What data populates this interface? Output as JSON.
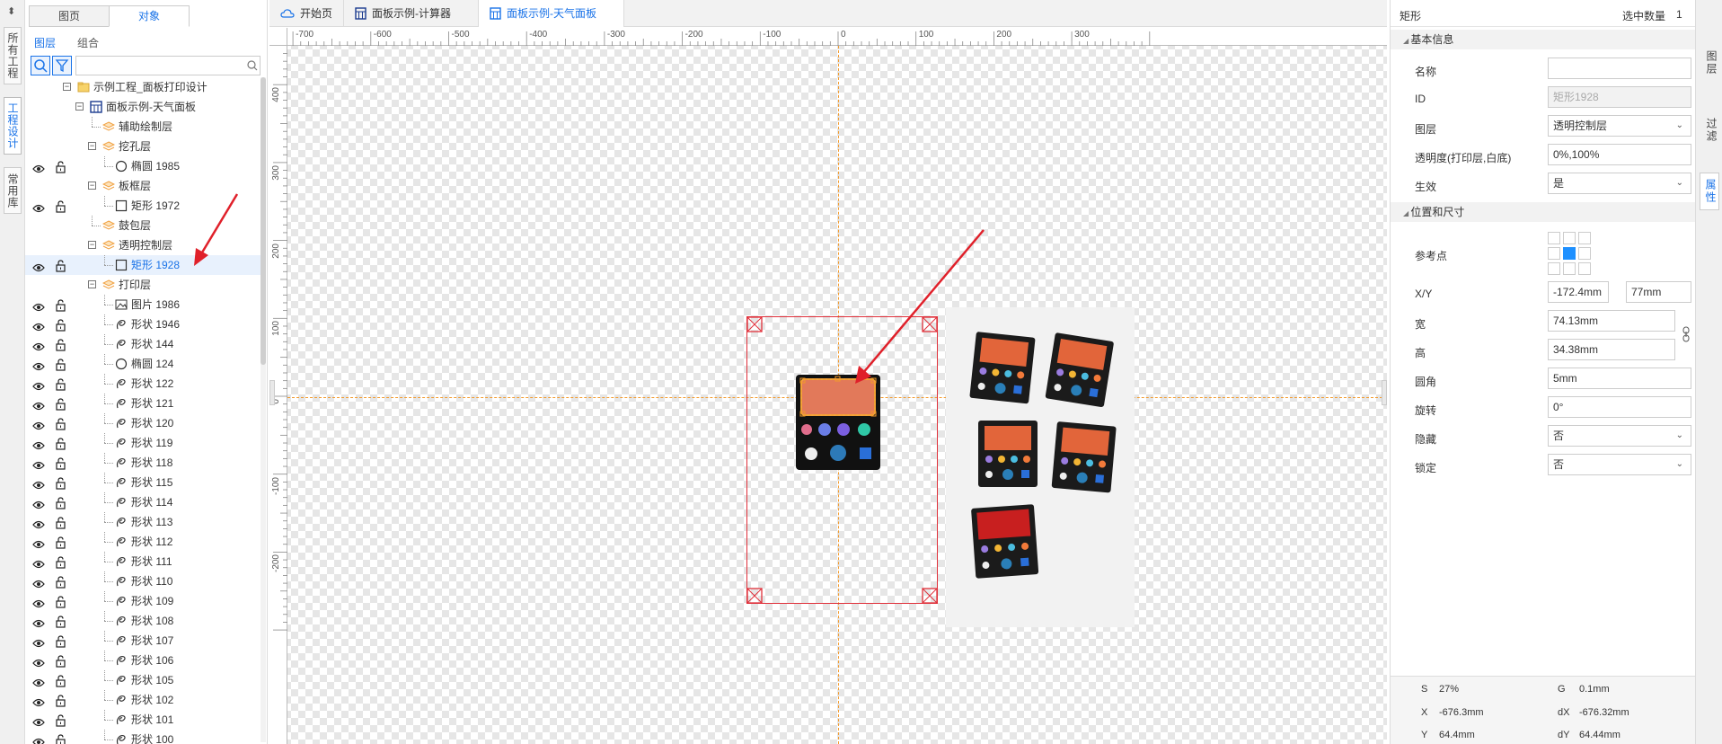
{
  "left_rail": {
    "pin": "⬍",
    "tabs": [
      "所有工程",
      "工程设计",
      "常用库"
    ]
  },
  "tree_panel": {
    "tabs": [
      "图页",
      "对象"
    ],
    "sub_tabs": [
      "图层",
      "组合"
    ],
    "search_placeholder": "",
    "rows": [
      {
        "label": "示例工程_面板打印设计",
        "icon": "folder-icon",
        "level": 0,
        "vis": false
      },
      {
        "label": "面板示例-天气面板",
        "icon": "panel-icon",
        "level": 1,
        "vis": false
      },
      {
        "label": "辅助绘制层",
        "icon": "layer-icon",
        "level": 2,
        "vis": false
      },
      {
        "label": "挖孔层",
        "icon": "layer-icon",
        "level": 2,
        "vis": false,
        "exp": true
      },
      {
        "label": "椭圆 1985",
        "icon": "ellipse-icon",
        "level": 3,
        "vis": true
      },
      {
        "label": "板框层",
        "icon": "layer-icon",
        "level": 2,
        "vis": false,
        "exp": true
      },
      {
        "label": "矩形 1972",
        "icon": "rect-icon",
        "level": 3,
        "vis": true
      },
      {
        "label": "鼓包层",
        "icon": "layer-icon",
        "level": 2,
        "vis": false
      },
      {
        "label": "透明控制层",
        "icon": "layer-icon",
        "level": 2,
        "vis": false,
        "exp": true
      },
      {
        "label": "矩形 1928",
        "icon": "rect-icon",
        "level": 3,
        "vis": true,
        "sel": true
      },
      {
        "label": "打印层",
        "icon": "layer-icon",
        "level": 2,
        "vis": false,
        "exp": true
      },
      {
        "label": "图片 1986",
        "icon": "image-icon",
        "level": 3,
        "vis": true
      },
      {
        "label": "形状 1946",
        "icon": "shape-icon",
        "level": 3,
        "vis": true
      },
      {
        "label": "形状 144",
        "icon": "shape-icon",
        "level": 3,
        "vis": true
      },
      {
        "label": "椭圆 124",
        "icon": "ellipse-icon",
        "level": 3,
        "vis": true
      },
      {
        "label": "形状 122",
        "icon": "shape-icon",
        "level": 3,
        "vis": true
      },
      {
        "label": "形状 121",
        "icon": "shape-icon",
        "level": 3,
        "vis": true
      },
      {
        "label": "形状 120",
        "icon": "shape-icon",
        "level": 3,
        "vis": true
      },
      {
        "label": "形状 119",
        "icon": "shape-icon",
        "level": 3,
        "vis": true
      },
      {
        "label": "形状 118",
        "icon": "shape-icon",
        "level": 3,
        "vis": true
      },
      {
        "label": "形状 115",
        "icon": "shape-icon",
        "level": 3,
        "vis": true
      },
      {
        "label": "形状 114",
        "icon": "shape-icon",
        "level": 3,
        "vis": true
      },
      {
        "label": "形状 113",
        "icon": "shape-icon",
        "level": 3,
        "vis": true
      },
      {
        "label": "形状 112",
        "icon": "shape-icon",
        "level": 3,
        "vis": true
      },
      {
        "label": "形状 111",
        "icon": "shape-icon",
        "level": 3,
        "vis": true
      },
      {
        "label": "形状 110",
        "icon": "shape-icon",
        "level": 3,
        "vis": true
      },
      {
        "label": "形状 109",
        "icon": "shape-icon",
        "level": 3,
        "vis": true
      },
      {
        "label": "形状 108",
        "icon": "shape-icon",
        "level": 3,
        "vis": true
      },
      {
        "label": "形状 107",
        "icon": "shape-icon",
        "level": 3,
        "vis": true
      },
      {
        "label": "形状 106",
        "icon": "shape-icon",
        "level": 3,
        "vis": true
      },
      {
        "label": "形状 105",
        "icon": "shape-icon",
        "level": 3,
        "vis": true
      },
      {
        "label": "形状 102",
        "icon": "shape-icon",
        "level": 3,
        "vis": true
      },
      {
        "label": "形状 101",
        "icon": "shape-icon",
        "level": 3,
        "vis": true
      },
      {
        "label": "形状 100",
        "icon": "shape-icon",
        "level": 3,
        "vis": true
      }
    ]
  },
  "doc_tabs": [
    {
      "label": "开始页",
      "icon": "cloud-icon",
      "active": false
    },
    {
      "label": "面板示例-计算器",
      "icon": "calculator-icon",
      "active": false
    },
    {
      "label": "面板示例-天气面板",
      "icon": "calculator-icon",
      "active": true
    }
  ],
  "canvas": {
    "h_ruler": [
      "-700",
      "-600",
      "-500",
      "-400",
      "-300",
      "-200",
      "-100",
      "0",
      "100",
      "200",
      "300"
    ],
    "v_ruler": [
      "400",
      "300",
      "200",
      "100",
      "0",
      "-100",
      "-200"
    ]
  },
  "properties": {
    "title": "矩形",
    "selected_count_label": "选中数量",
    "selected_count": "1",
    "basic_section": "基本信息",
    "name_label": "名称",
    "name_value": "",
    "id_label": "ID",
    "id_value": "矩形1928",
    "layer_label": "图层",
    "layer_value": "透明控制层",
    "opacity_label": "透明度(打印层,白底)",
    "opacity_value": "0%,100%",
    "effective_label": "生效",
    "effective_value": "是",
    "pos_section": "位置和尺寸",
    "ref_label": "参考点",
    "xy_label": "X/Y",
    "x_value": "-172.4mm",
    "y_value": "77mm",
    "width_label": "宽",
    "width_value": "74.13mm",
    "height_label": "高",
    "height_value": "34.38mm",
    "radius_label": "圆角",
    "radius_value": "5mm",
    "rotate_label": "旋转",
    "rotate_value": "0°",
    "hidden_label": "隐藏",
    "hidden_value": "否",
    "lock_label": "锁定",
    "lock_value": "否"
  },
  "status": {
    "s_label": "S",
    "s_value": "27%",
    "g_label": "G",
    "g_value": "0.1mm",
    "x_label": "X",
    "x_value": "-676.3mm",
    "dx_label": "dX",
    "dx_value": "-676.32mm",
    "y_label": "Y",
    "y_value": "64.4mm",
    "dy_label": "dY",
    "dy_value": "64.44mm"
  },
  "right_rail": {
    "tabs": [
      "图层",
      "过滤",
      "属性"
    ]
  },
  "colors": {
    "accent": "#1a73e8",
    "guide": "#f39a2b",
    "selection": "#e0303a"
  }
}
